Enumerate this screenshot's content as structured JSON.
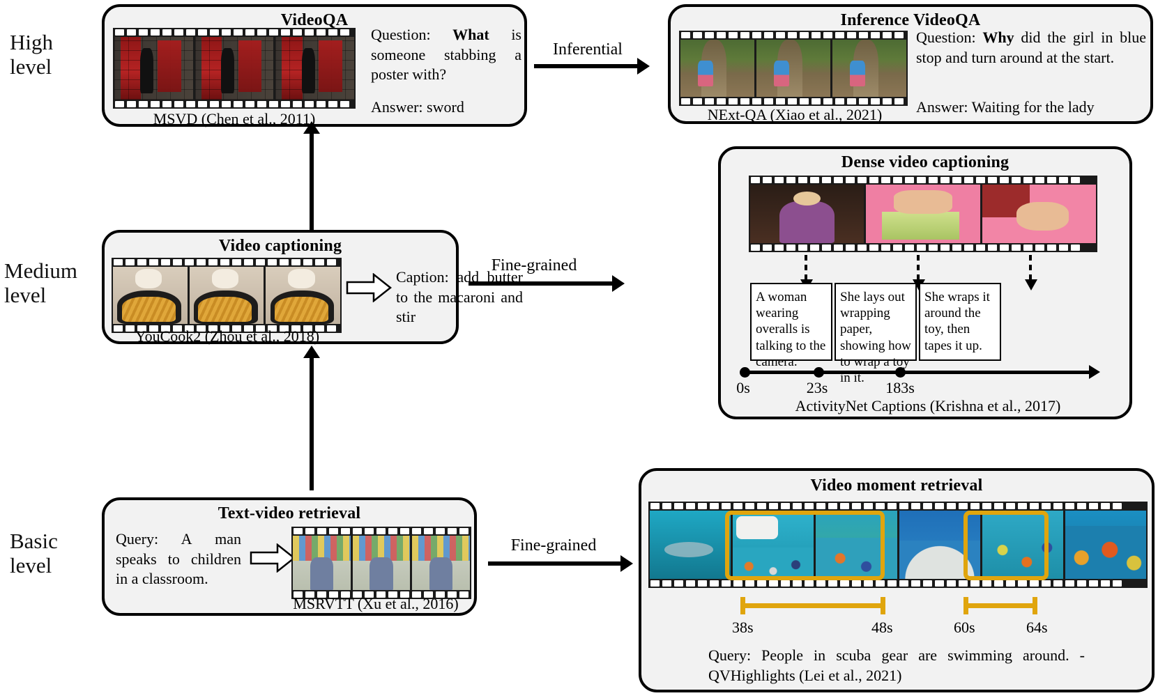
{
  "levels": [
    {
      "line1": "High",
      "line2": "level"
    },
    {
      "line1": "Medium",
      "line2": "level"
    },
    {
      "line1": "Basic",
      "line2": "level"
    }
  ],
  "transitions": [
    {
      "label": "Inferential"
    },
    {
      "label": "Fine-grained"
    },
    {
      "label": "Fine-grained"
    }
  ],
  "panels": {
    "videoqa": {
      "title": "VideoQA",
      "dataset": "MSVD (Chen et al., 2011)",
      "question_prefix": "Question:",
      "question_bold": "What",
      "question_rest": "is someone stabbing a poster with?",
      "answer": "Answer: sword"
    },
    "inference_videoqa": {
      "title": "Inference VideoQA",
      "dataset": "NExt-QA (Xiao et al., 2021)",
      "question_prefix": "Question:",
      "question_bold": "Why",
      "question_rest": "did the girl in blue stop and turn around at the start.",
      "answer": "Answer: Waiting for the lady"
    },
    "video_captioning": {
      "title": "Video captioning",
      "dataset": "YouCook2 (Zhou et al., 2018)",
      "caption": "Caption: add butter to the macaroni and stir"
    },
    "dense_video_captioning": {
      "title": "Dense video captioning",
      "dataset": "ActivityNet Captions (Krishna et al., 2017)",
      "segments": [
        "A woman wearing overalls is talking to the camera.",
        "She lays out wrapping paper, showing how to wrap a toy in it.",
        "She wraps it around the toy, then tapes it up."
      ],
      "timestamps": [
        "0s",
        "23s",
        "183s"
      ]
    },
    "text_video_retrieval": {
      "title": "Text-video retrieval",
      "dataset": "MSRVTT (Xu et al., 2016)",
      "query": "Query: A man speaks to children in a classroom."
    },
    "video_moment_retrieval": {
      "title": "Video moment retrieval",
      "query": "Query: People in scuba gear are swimming around. - QVHighlights (Lei et al., 2021)",
      "spans": [
        {
          "start": "38s",
          "end": "48s"
        },
        {
          "start": "60s",
          "end": "64s"
        }
      ],
      "highlight_color": "#e0a50d"
    }
  }
}
